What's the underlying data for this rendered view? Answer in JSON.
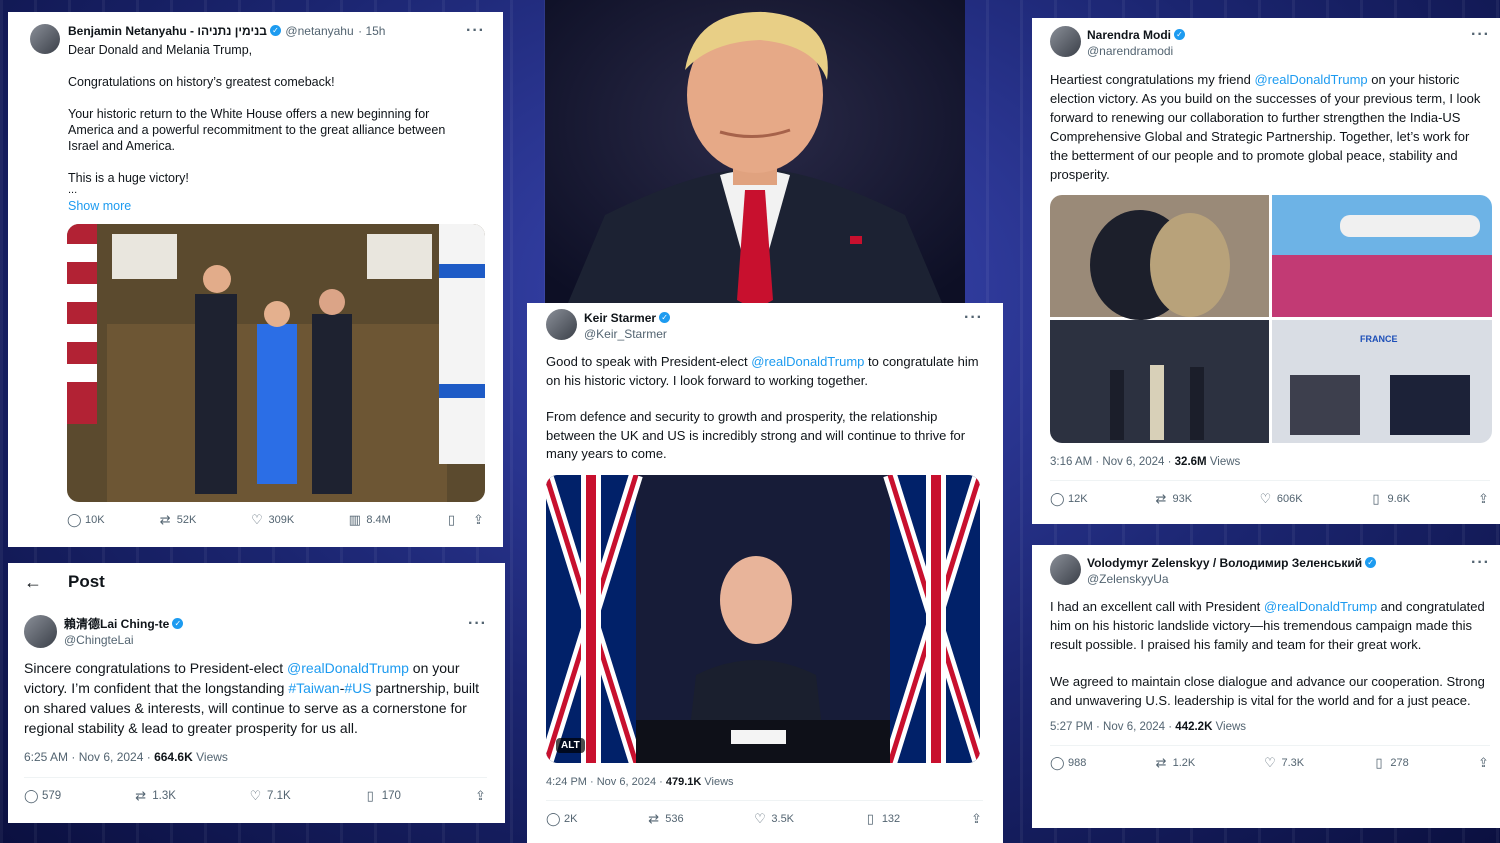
{
  "netanyahu": {
    "name": "Benjamin Netanyahu - בנימין נתניהו",
    "handle": "@netanyahu",
    "time": "· 15h",
    "paragraphs": [
      "Dear Donald and Melania Trump,",
      "Congratulations on history’s greatest comeback!",
      "Your historic return to the White House offers a new beginning for America and a powerful recommitment to the great alliance between Israel and America.",
      "This is a huge victory!"
    ],
    "ellipsis": "...",
    "show_more": "Show more",
    "stats": {
      "replies": "10K",
      "reposts": "52K",
      "likes": "309K",
      "views": "8.4M"
    }
  },
  "lai": {
    "page_title": "Post",
    "name": "賴清德Lai Ching-te",
    "handle": "@ChingteLai",
    "text_a": "Sincere congratulations to President-elect ",
    "mention": "@realDonaldTrump",
    "text_b": " on your victory. I’m confident that the longstanding ",
    "tag1": "#Taiwan",
    "dash": "-",
    "tag2": "#US",
    "text_c": " partnership, built on shared values & interests, will continue to serve as a cornerstone for regional stability & lead to greater prosperity for us all.",
    "time": "6:25 AM · Nov 6, 2024 · ",
    "views": "664.6K",
    "views_label": " Views",
    "stats": {
      "replies": "579",
      "reposts": "1.3K",
      "likes": "7.1K",
      "bookmarks": "170"
    }
  },
  "starmer": {
    "name": "Keir Starmer",
    "handle": "@Keir_Starmer",
    "text_a": "Good to speak with President-elect ",
    "mention": "@realDonaldTrump",
    "text_b": " to congratulate him on his historic victory. I look forward to working together.",
    "para2": "From defence and security to growth and prosperity, the relationship between the UK and US is incredibly strong and will continue to thrive for many years to come.",
    "alt": "ALT",
    "time": "4:24 PM · Nov 6, 2024 · ",
    "views": "479.1K",
    "views_label": " Views",
    "stats": {
      "replies": "2K",
      "reposts": "536",
      "likes": "3.5K",
      "bookmarks": "132"
    }
  },
  "modi": {
    "name": "Narendra Modi",
    "handle": "@narendramodi",
    "text_a": "Heartiest congratulations my friend ",
    "mention": "@realDonaldTrump",
    "text_b": " on your historic election victory. As you build on the successes of your previous term, I look forward to renewing our collaboration to further strengthen the India-US Comprehensive Global and Strategic Partnership. Together, let’s work for the betterment of our people and to promote global peace, stability and prosperity.",
    "photo_text": "FRANCE",
    "time": "3:16 AM · Nov 6, 2024 · ",
    "views": "32.6M",
    "views_label": " Views",
    "stats": {
      "replies": "12K",
      "reposts": "93K",
      "likes": "606K",
      "bookmarks": "9.6K"
    }
  },
  "zelensky": {
    "name": "Volodymyr Zelenskyy / Володимир Зеленський",
    "handle": "@ZelenskyyUa",
    "text_a": "I had an excellent call with President ",
    "mention": "@realDonaldTrump",
    "text_b": " and congratulated him on his historic landslide victory—his tremendous campaign made this result possible. I praised his family and team for their great work.",
    "para2": "We agreed to maintain close dialogue and advance our cooperation. Strong and unwavering U.S. leadership is vital for the world and for a just peace.",
    "time": "5:27 PM · Nov 6, 2024 · ",
    "views": "442.2K",
    "views_label": " Views",
    "stats": {
      "replies": "988",
      "reposts": "1.2K",
      "likes": "7.3K",
      "bookmarks": "278"
    }
  },
  "icons": {
    "reply": "speech-bubble",
    "repost": "arrows-cycle",
    "like": "heart",
    "views": "bar-chart",
    "bookmark": "bookmark",
    "share": "upload-arrow",
    "back": "left-arrow",
    "more": "ellipsis"
  },
  "colors": {
    "link": "#1d9bf0",
    "text": "#0f1419",
    "muted": "#536471",
    "background": "#1d2a78"
  }
}
